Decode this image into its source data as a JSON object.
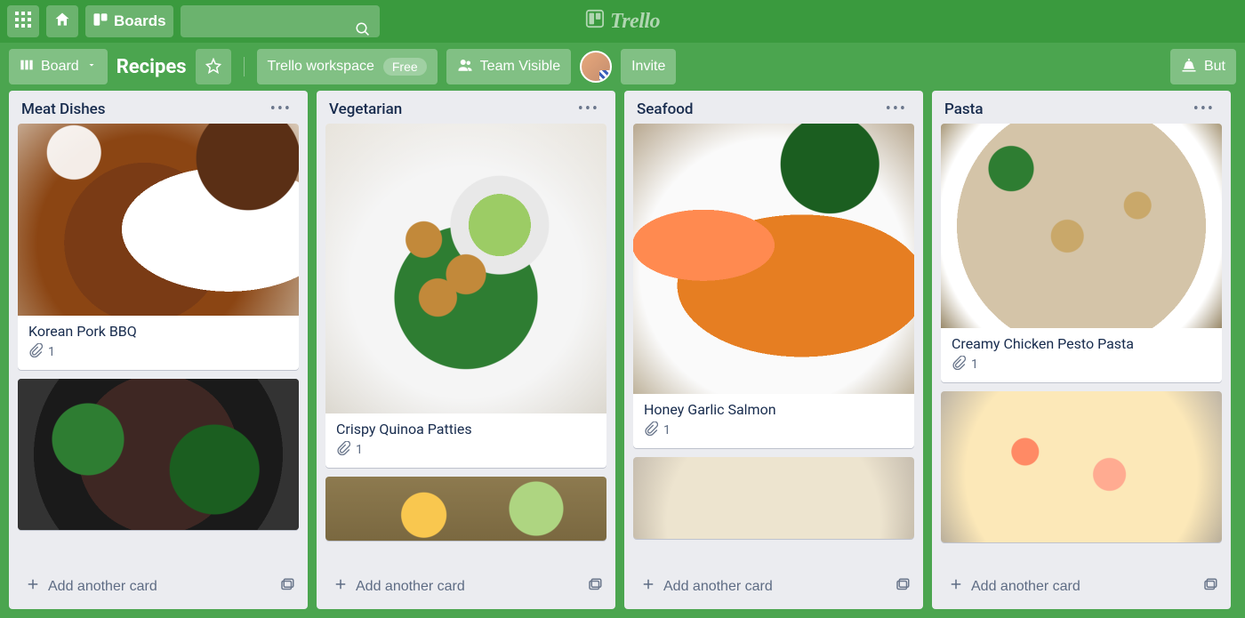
{
  "header": {
    "boards_label": "Boards",
    "logo_text": "Trello",
    "search_placeholder": ""
  },
  "board_bar": {
    "view_label": "Board",
    "board_title": "Recipes",
    "workspace_label": "Trello workspace",
    "workspace_plan": "Free",
    "visibility_label": "Team Visible",
    "invite_label": "Invite",
    "butler_label": "But"
  },
  "lists": [
    {
      "title": "Meat Dishes",
      "add_label": "Add another card",
      "cards": [
        {
          "title": "Korean Pork BBQ",
          "attachments": 1,
          "cover": "cover-meat1"
        },
        {
          "title": "",
          "attachments": null,
          "cover": "cover-meat2"
        }
      ]
    },
    {
      "title": "Vegetarian",
      "add_label": "Add another card",
      "cards": [
        {
          "title": "Crispy Quinoa Patties",
          "attachments": 1,
          "cover": "cover-veg1"
        },
        {
          "title": "",
          "attachments": null,
          "cover": "cover-veg2"
        }
      ]
    },
    {
      "title": "Seafood",
      "add_label": "Add another card",
      "cards": [
        {
          "title": "Honey Garlic Salmon",
          "attachments": 1,
          "cover": "cover-sea1"
        },
        {
          "title": "",
          "attachments": null,
          "cover": "cover-sea2"
        }
      ]
    },
    {
      "title": "Pasta",
      "add_label": "Add another card",
      "cards": [
        {
          "title": "Creamy Chicken Pesto Pasta",
          "attachments": 1,
          "cover": "cover-pasta1"
        },
        {
          "title": "",
          "attachments": null,
          "cover": "cover-pasta2"
        }
      ]
    }
  ]
}
